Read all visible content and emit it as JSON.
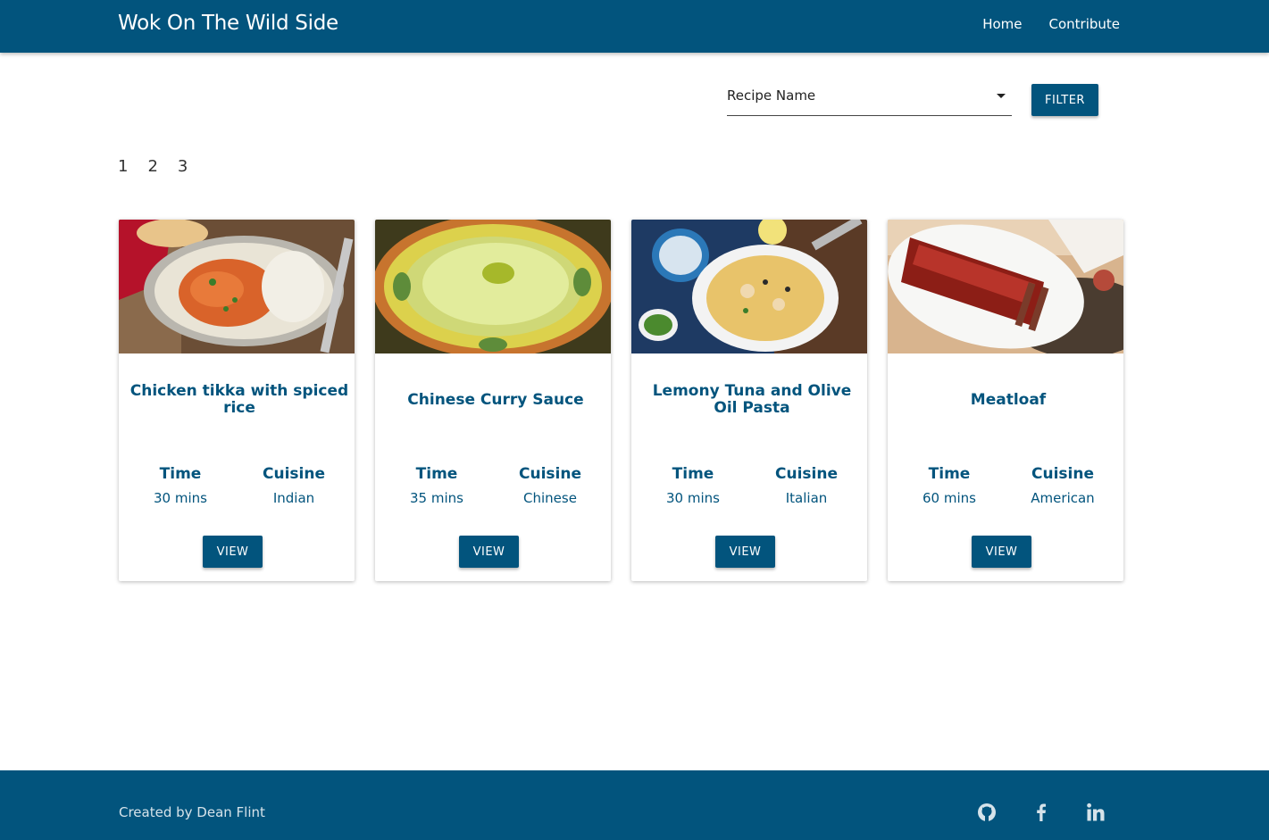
{
  "navbar": {
    "brand": "Wok On The Wild Side",
    "links": [
      "Home",
      "Contribute"
    ]
  },
  "filter": {
    "select_value": "Recipe Name",
    "button_label": "FILTER"
  },
  "pagination": [
    "1",
    "2",
    "3"
  ],
  "labels": {
    "time": "Time",
    "cuisine": "Cuisine",
    "view": "VIEW"
  },
  "recipes": [
    {
      "title": "Chicken tikka with spiced rice",
      "time": "30 mins",
      "cuisine": "Indian"
    },
    {
      "title": "Chinese Curry Sauce",
      "time": "35 mins",
      "cuisine": "Chinese"
    },
    {
      "title": "Lemony Tuna and Olive Oil Pasta",
      "time": "30 mins",
      "cuisine": "Italian"
    },
    {
      "title": "Meatloaf",
      "time": "60 mins",
      "cuisine": "American"
    }
  ],
  "footer": {
    "credit": "Created by Dean Flint",
    "social_icons": [
      "github-icon",
      "facebook-icon",
      "linkedin-icon"
    ]
  },
  "colors": {
    "primary": "#02547d",
    "background": "#ffffff"
  }
}
